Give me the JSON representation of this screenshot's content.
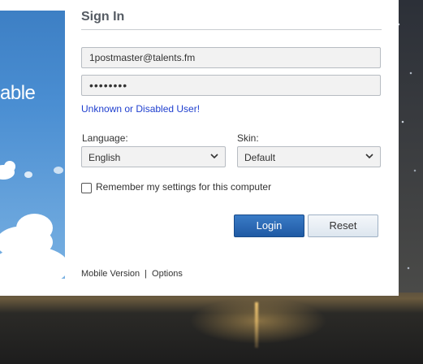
{
  "form": {
    "title": "Sign In",
    "username_value": "1postmaster@talents.fm",
    "password_mask": "••••••••",
    "error_text": "Unknown or Disabled User!",
    "language_label": "Language:",
    "language_value": "English",
    "skin_label": "Skin:",
    "skin_value": "Default",
    "remember_label": "Remember my settings for this computer",
    "remember_checked": false,
    "login_label": "Login",
    "reset_label": "Reset"
  },
  "promo": {
    "text": "able"
  },
  "footer": {
    "mobile_link": "Mobile Version",
    "separator": "|",
    "options_link": "Options"
  },
  "colors": {
    "login_button": "#2a68b4",
    "error_link": "#1f3fcf",
    "promo_blue": "#4a8ed2"
  },
  "icons": {
    "select_chevron": "chevron-down-icon"
  }
}
